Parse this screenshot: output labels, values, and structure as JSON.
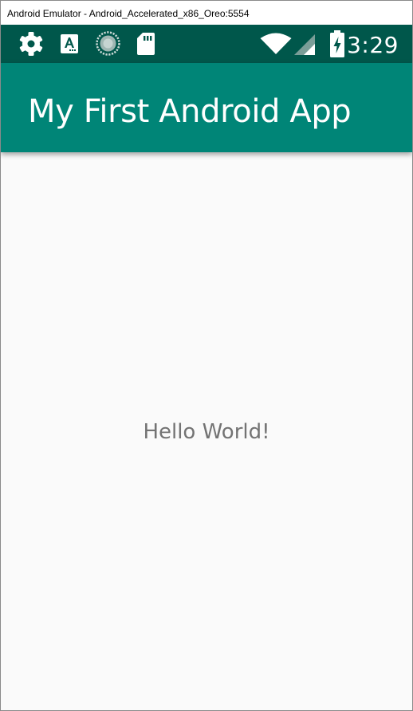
{
  "window": {
    "title": "Android Emulator - Android_Accelerated_x86_Oreo:5554"
  },
  "status_bar": {
    "left_icons": [
      "settings-gear-icon",
      "font-a-icon",
      "sync-progress-icon",
      "sd-card-icon"
    ],
    "right_icons": [
      "wifi-icon",
      "cell-signal-icon",
      "battery-charging-icon"
    ],
    "time": "3:29"
  },
  "app_bar": {
    "title": "My First Android App"
  },
  "content": {
    "text": "Hello World!"
  },
  "colors": {
    "status_bar": "#00574b",
    "app_bar": "#008577",
    "background": "#fafafa",
    "text": "#737373"
  }
}
